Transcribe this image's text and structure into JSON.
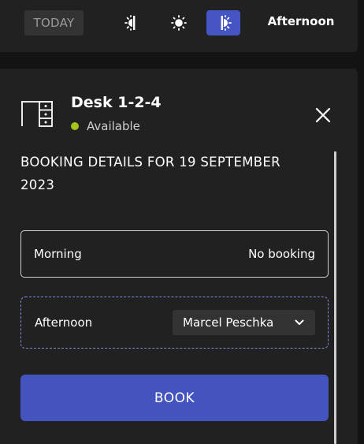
{
  "header": {
    "today_label": "TODAY",
    "periods": [
      {
        "icon": "sunrise-icon",
        "active": false
      },
      {
        "icon": "sun-icon",
        "active": false
      },
      {
        "icon": "sunset-icon",
        "active": true
      }
    ],
    "current_period": "Afternoon"
  },
  "panel": {
    "desk_icon": "desk-icon",
    "desk_name": "Desk 1-2-4",
    "status": "Available",
    "status_color": "#a3c51a",
    "heading": "BOOKING DETAILS FOR 19 SEPTEMBER 2023",
    "morning": {
      "label": "Morning",
      "value": "No booking"
    },
    "afternoon": {
      "label": "Afternoon",
      "selected_user": "Marcel Peschka"
    },
    "book_label": "BOOK"
  },
  "colors": {
    "accent": "#4454bf",
    "background": "#131313",
    "surface": "#212121"
  }
}
